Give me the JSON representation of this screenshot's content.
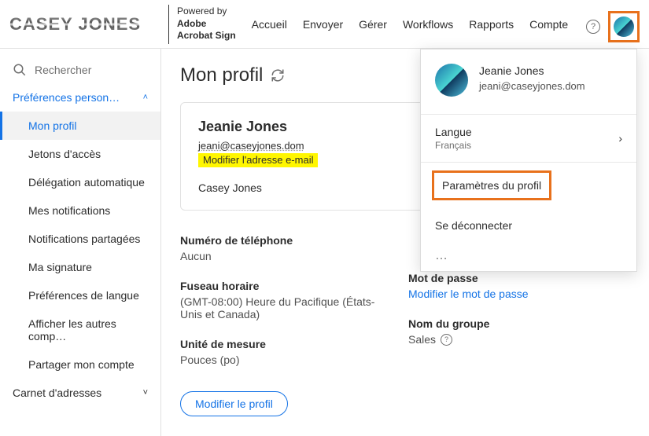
{
  "logo_text": "CASEY JONES",
  "brand": {
    "powered": "Powered by",
    "line1": "Adobe",
    "line2": "Acrobat Sign"
  },
  "nav": [
    "Accueil",
    "Envoyer",
    "Gérer",
    "Workflows",
    "Rapports",
    "Compte"
  ],
  "search_placeholder": "Rechercher",
  "sidebar": {
    "prefs_header": "Préférences person…",
    "items": [
      "Mon profil",
      "Jetons d'accès",
      "Délégation automatique",
      "Mes notifications",
      "Notifications partagées",
      "Ma signature",
      "Préférences de langue",
      "Afficher les autres comp…",
      "Partager mon compte"
    ],
    "addr_header": "Carnet d'adresses"
  },
  "page_title": "Mon profil",
  "profile": {
    "name": "Jeanie Jones",
    "email": "jeani@caseyjones.dom",
    "edit_email": "Modifier l'adresse e-mail",
    "company": "Casey Jones"
  },
  "left": {
    "phone_label": "Numéro de téléphone",
    "phone_val": "Aucun",
    "tz_label": "Fuseau horaire",
    "tz_val": "(GMT-08:00) Heure du Pacifique (États-Unis et Canada)",
    "unit_label": "Unité de mesure",
    "unit_val": "Pouces (po)"
  },
  "right": {
    "pwd_label": "Mot de passe",
    "pwd_link": "Modifier le mot de passe",
    "group_label": "Nom du groupe",
    "group_val": "Sales"
  },
  "edit_profile": "Modifier le profil",
  "dropdown": {
    "name": "Jeanie Jones",
    "email": "jeani@caseyjones.dom",
    "lang_label": "Langue",
    "lang_val": "Français",
    "profile_settings": "Paramètres du profil",
    "signout": "Se déconnecter"
  }
}
